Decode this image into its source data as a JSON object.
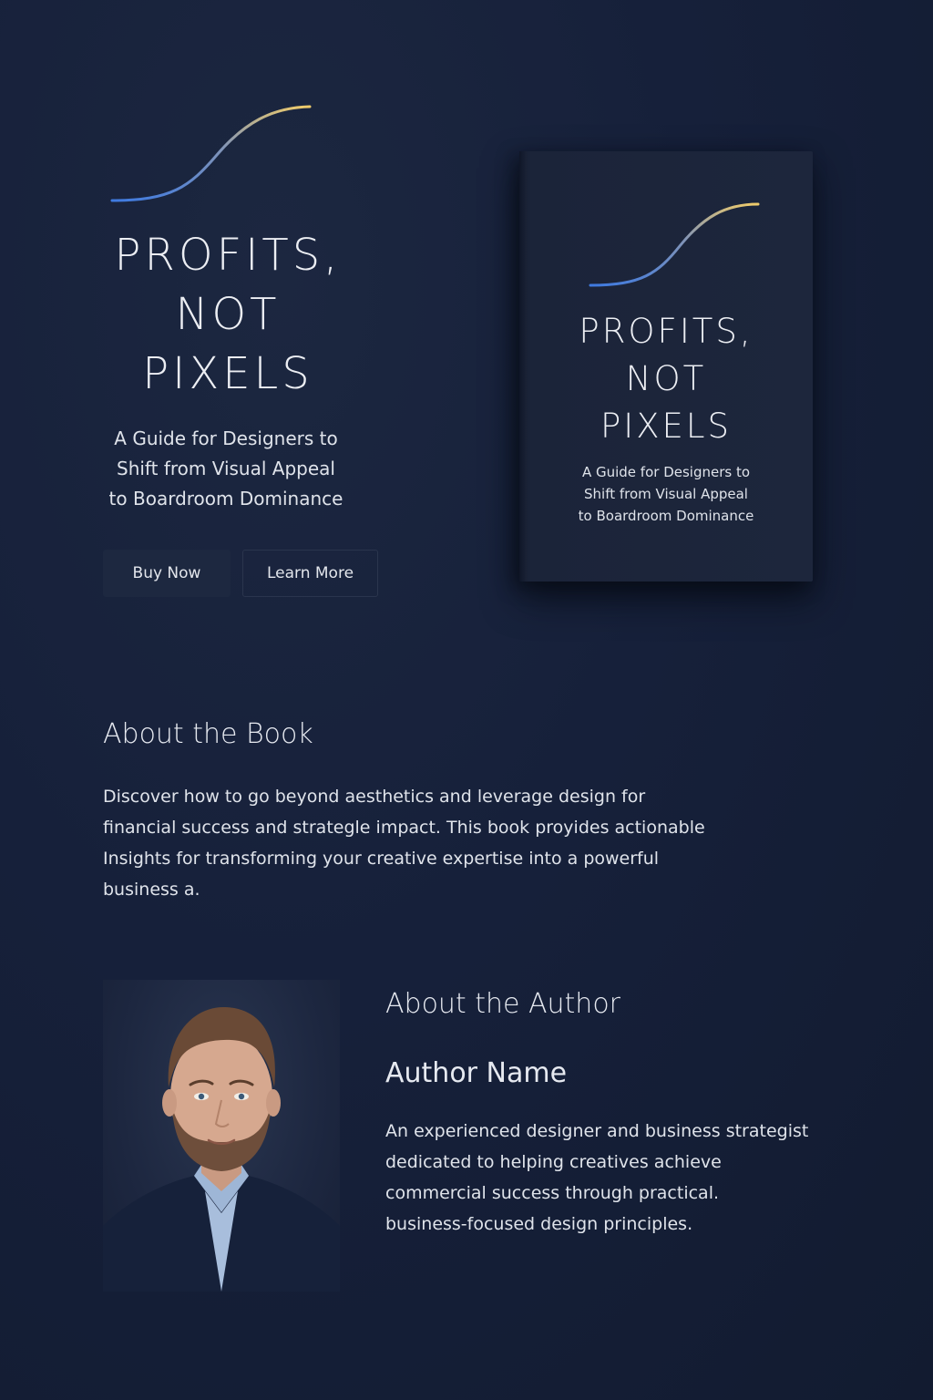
{
  "hero": {
    "title_lines": [
      "PROFITS,",
      "NOT",
      "PIXELS"
    ],
    "subtitle_lines": [
      "A Guide for Designers to",
      "Shift from Visual Appeal",
      "to Boardroom Dominance"
    ],
    "buy_label": "Buy Now",
    "learn_label": "Learn More"
  },
  "book_cover": {
    "title_lines": [
      "PROFITS,",
      "NOT",
      "PIXELS"
    ],
    "subtitle_lines": [
      "A Guide for Designers to",
      "Shift from Visual Appeal",
      "to Boardroom Dominance"
    ]
  },
  "about_book": {
    "heading": "About the Book",
    "text": "Discover how to go beyond aesthetics and leverage design for financial success and strategle impact. This book proyides actionable Insights for transforming your creative expertise into a powerful business a."
  },
  "about_author": {
    "heading": "About the Author",
    "name": "Author Name",
    "bio_lines": [
      "An experienced designer and business strategist",
      "dedicated to helping creatives achieve",
      "commercial success through practical.",
      "business-focused design principles."
    ]
  },
  "colors": {
    "background": "#16203a",
    "curve_start": "#3f7ae0",
    "curve_end": "#f0cc6a",
    "button_bg": "#1d2840",
    "text": "#e6e9f0"
  },
  "icons": {
    "logo_mark": "growth-curve-icon"
  }
}
